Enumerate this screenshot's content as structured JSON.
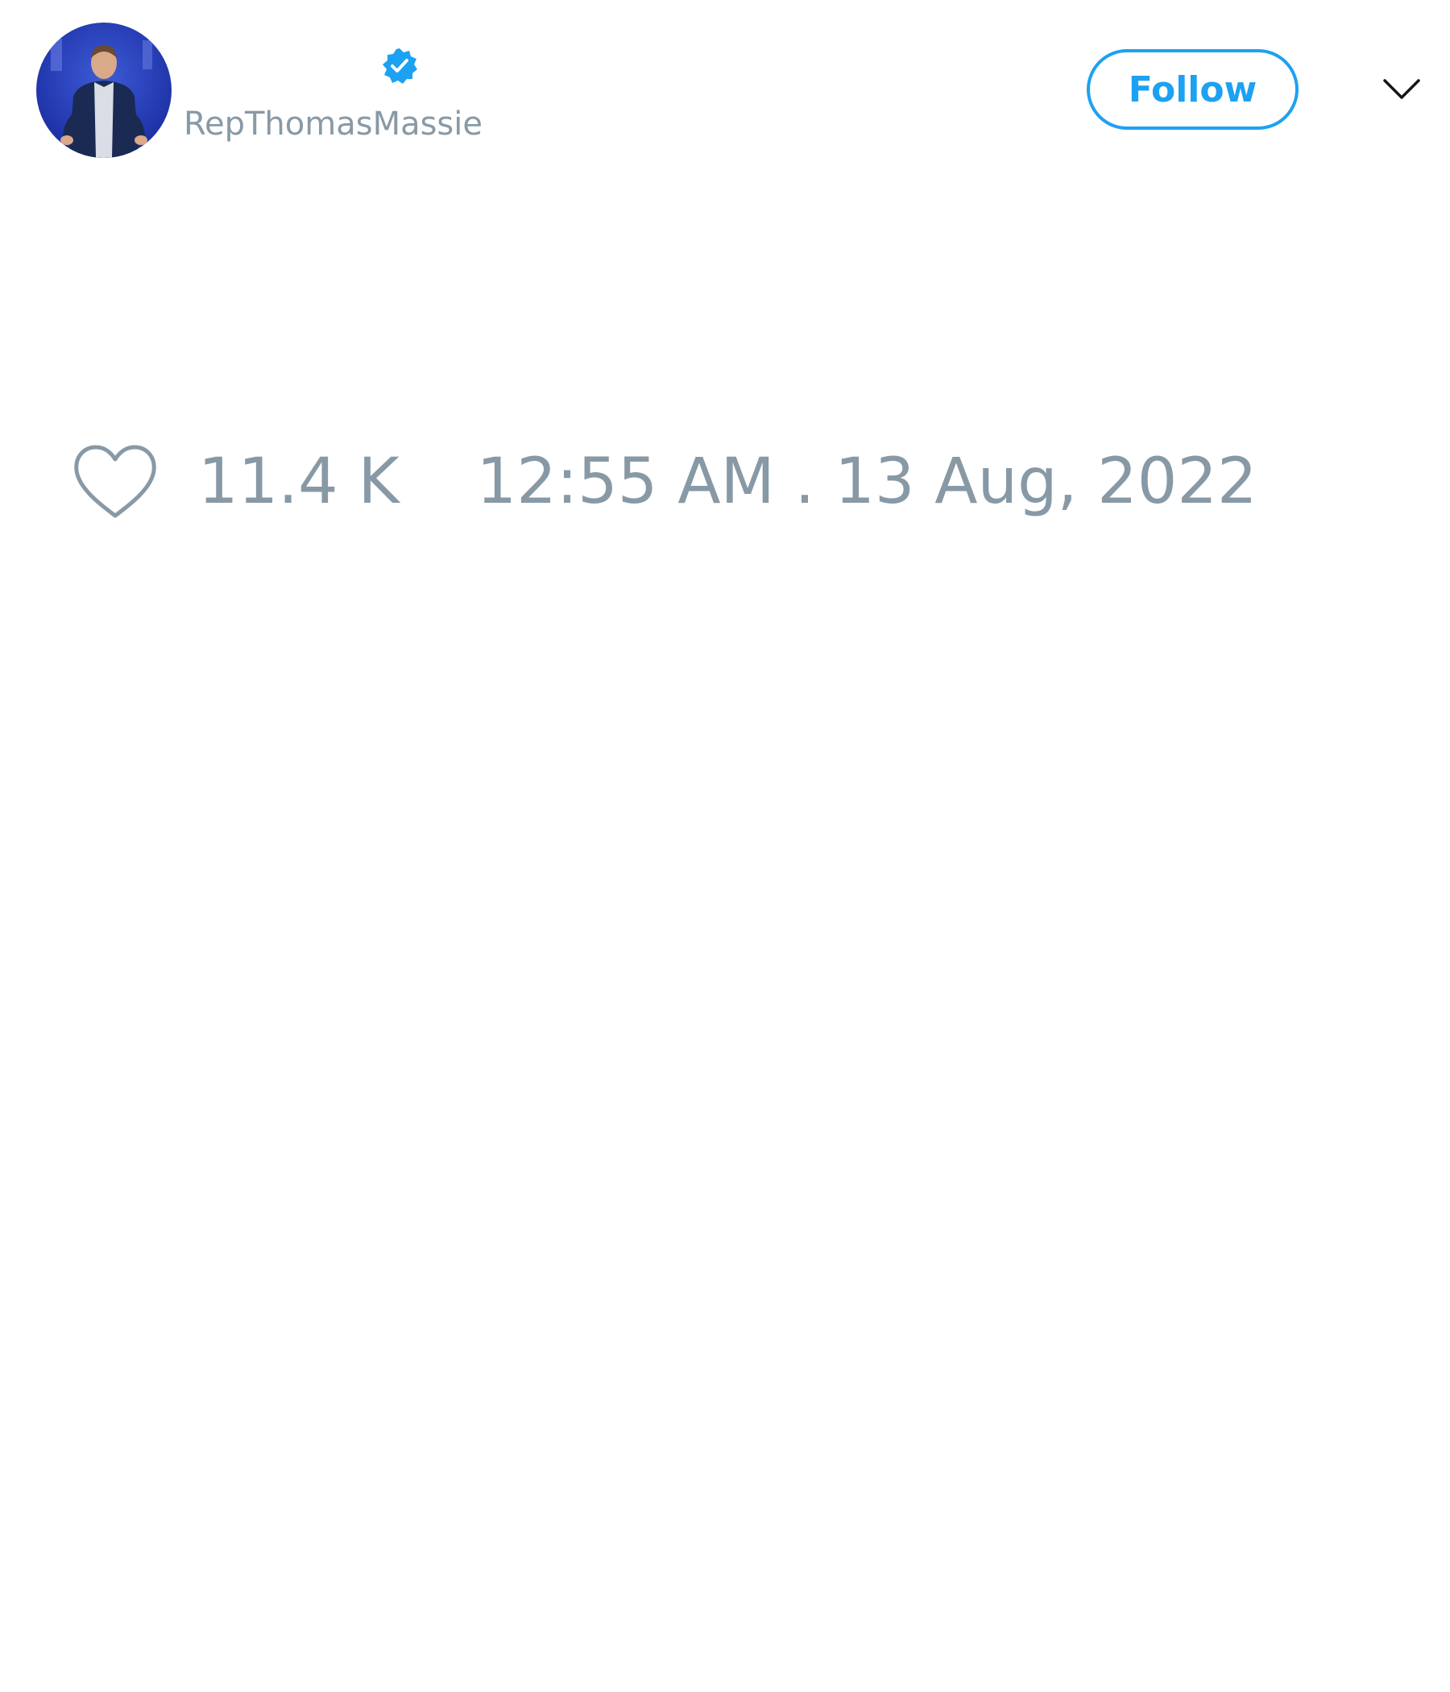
{
  "author": {
    "display_name": "",
    "handle": "RepThomasMassie",
    "verified": true,
    "avatar_icon": "avatar-photo"
  },
  "follow_button": {
    "label": "Follow"
  },
  "more_menu": {
    "icon": "chevron-down-icon"
  },
  "tweet": {
    "text": ""
  },
  "metrics": {
    "like_icon": "heart-outline-icon",
    "like_count": "11.4 K",
    "timestamp": "12:55 AM . 13 Aug, 2022"
  },
  "colors": {
    "accent": "#1da1f2",
    "muted_text": "#8899a6",
    "background": "#ffffff",
    "avatar_background": "#1f3db5"
  }
}
